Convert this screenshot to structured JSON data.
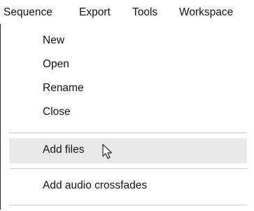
{
  "menubar": {
    "items": [
      {
        "label": "Sequence"
      },
      {
        "label": "Export"
      },
      {
        "label": "Tools"
      },
      {
        "label": "Workspace"
      }
    ]
  },
  "menu": {
    "items": [
      {
        "label": "New"
      },
      {
        "label": "Open"
      },
      {
        "label": "Rename"
      },
      {
        "label": "Close"
      },
      {
        "label": "Add files"
      },
      {
        "label": "Add audio crossfades"
      }
    ],
    "hovered_item": "Add files"
  },
  "colors": {
    "hover_background": "#e9e9e9",
    "separator": "#cfcfcf",
    "text": "#111111"
  },
  "icons": {
    "cursor": "mouse-pointer-icon"
  }
}
